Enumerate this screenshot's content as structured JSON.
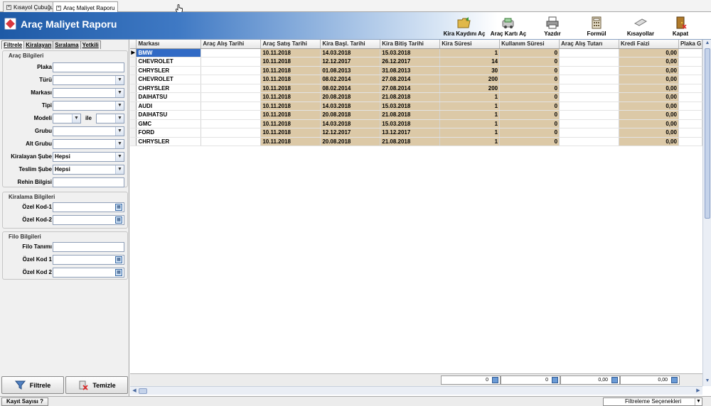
{
  "tabs": [
    {
      "label": "Kısayol Çubuğu",
      "active": false
    },
    {
      "label": "Araç Maliyet Raporu",
      "active": true
    }
  ],
  "header": {
    "title": "Araç Maliyet Raporu",
    "toolbar": [
      {
        "label": "Kira Kaydını Aç",
        "icon": "folder-open-icon"
      },
      {
        "label": "Araç Kartı Aç",
        "icon": "car-card-icon"
      },
      {
        "label": "Yazdır",
        "icon": "printer-icon"
      },
      {
        "label": "Formül",
        "icon": "calculator-icon"
      },
      {
        "label": "Kısayollar",
        "icon": "shortcut-icon"
      },
      {
        "label": "Kapat",
        "icon": "exit-door-icon"
      }
    ]
  },
  "left_tabs": [
    {
      "label": "Filtrele",
      "active": true
    },
    {
      "label": "Kiralayan",
      "active": false
    },
    {
      "label": "Sıralama",
      "active": false
    },
    {
      "label": "Yetkili",
      "active": false
    }
  ],
  "groups": {
    "arac": {
      "title": "Araç Bilgileri",
      "fields": {
        "plaka": {
          "label": "Plaka",
          "value": ""
        },
        "turu": {
          "label": "Türü",
          "value": ""
        },
        "markasi": {
          "label": "Markası",
          "value": ""
        },
        "tipi": {
          "label": "Tipi",
          "value": ""
        },
        "modeli": {
          "label": "Modeli",
          "value_from": "",
          "value_to": "",
          "sep": "ile"
        },
        "grubu": {
          "label": "Grubu",
          "value": ""
        },
        "alt_grubu": {
          "label": "Alt Grubu",
          "value": ""
        },
        "kiralayan_sube": {
          "label": "Kiralayan Şube",
          "value": "Hepsi"
        },
        "teslim_sube": {
          "label": "Teslim Şube",
          "value": "Hepsi"
        },
        "rehin": {
          "label": "Rehin Bilgisi",
          "value": ""
        }
      }
    },
    "kiralama": {
      "title": "Kiralama Bilgileri",
      "fields": {
        "ozel1": {
          "label": "Özel Kod-1",
          "value": ""
        },
        "ozel2": {
          "label": "Özel Kod-2",
          "value": ""
        }
      }
    },
    "filo": {
      "title": "Filo Bilgileri",
      "fields": {
        "tanimi": {
          "label": "Filo Tanımı",
          "value": ""
        },
        "ozel1": {
          "label": "Özel Kod 1",
          "value": ""
        },
        "ozel2": {
          "label": "Özel Kod 2",
          "value": ""
        }
      }
    }
  },
  "buttons": {
    "filter": "Filtrele",
    "clear": "Temizle"
  },
  "grid": {
    "columns": [
      "Markası",
      "Araç Alış Tarihi",
      "Araç Satış Tarihi",
      "Kira Başl. Tarihi",
      "Kira Bitiş Tarihi",
      "Kira Süresi",
      "Kullanım Süresi",
      "Araç Alış Tutarı",
      "Kredi Faizi",
      "Plaka G"
    ],
    "rows": [
      [
        "BMW",
        "",
        "10.11.2018",
        "14.03.2018",
        "15.03.2018",
        "1",
        "0",
        "",
        "0,00",
        ""
      ],
      [
        "CHEVROLET",
        "",
        "10.11.2018",
        "12.12.2017",
        "26.12.2017",
        "14",
        "0",
        "",
        "0,00",
        ""
      ],
      [
        "CHRYSLER",
        "",
        "10.11.2018",
        "01.08.2013",
        "31.08.2013",
        "30",
        "0",
        "",
        "0,00",
        ""
      ],
      [
        "CHEVROLET",
        "",
        "10.11.2018",
        "08.02.2014",
        "27.08.2014",
        "200",
        "0",
        "",
        "0,00",
        ""
      ],
      [
        "CHRYSLER",
        "",
        "10.11.2018",
        "08.02.2014",
        "27.08.2014",
        "200",
        "0",
        "",
        "0,00",
        ""
      ],
      [
        "DAIHATSU",
        "",
        "10.11.2018",
        "20.08.2018",
        "21.08.2018",
        "1",
        "0",
        "",
        "0,00",
        ""
      ],
      [
        "AUDI",
        "",
        "10.11.2018",
        "14.03.2018",
        "15.03.2018",
        "1",
        "0",
        "",
        "0,00",
        ""
      ],
      [
        "DAIHATSU",
        "",
        "10.11.2018",
        "20.08.2018",
        "21.08.2018",
        "1",
        "0",
        "",
        "0,00",
        ""
      ],
      [
        "GMC",
        "",
        "10.11.2018",
        "14.03.2018",
        "15.03.2018",
        "1",
        "0",
        "",
        "0,00",
        ""
      ],
      [
        "FORD",
        "",
        "10.11.2018",
        "12.12.2017",
        "13.12.2017",
        "1",
        "0",
        "",
        "0,00",
        ""
      ],
      [
        "CHRYSLER",
        "",
        "10.11.2018",
        "20.08.2018",
        "21.08.2018",
        "1",
        "0",
        "",
        "0,00",
        ""
      ]
    ],
    "footer": {
      "kira_suresi": "0",
      "kullanim_suresi": "0",
      "alis_tutari": "0,00",
      "kredi_faizi": "0,00"
    },
    "selected_row": 0
  },
  "status": {
    "record_count_btn": "Kayıt Sayısı ?",
    "filter_options": "Filtreleme Seçenekleri"
  },
  "colors": {
    "header_blue": "#1e5aa6",
    "tan_cell": "#dcc9a7",
    "selection": "#316ac5"
  }
}
